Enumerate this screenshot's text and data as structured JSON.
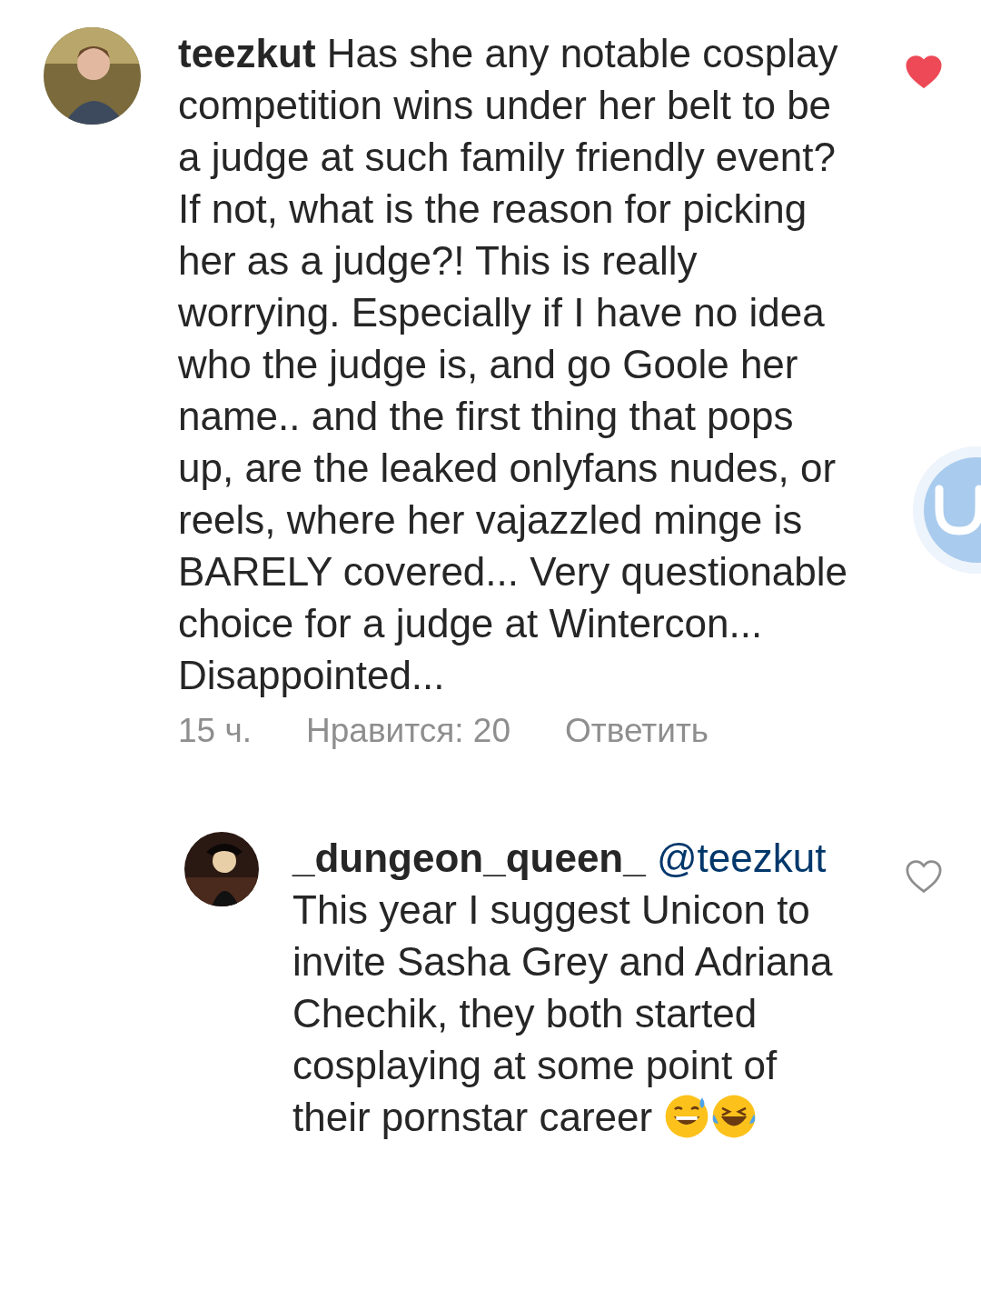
{
  "comments": [
    {
      "username": "teezkut",
      "text": "Has she any notable cosplay competition wins under her belt to be a judge at such family friendly event? If not, what is the reason for picking her as a judge?! This is really worrying. Especially if I have no idea who the judge is, and go Goole her name.. and the first thing that pops up, are the leaked onlyfans nudes, or reels, where her vajazzled minge is BARELY covered... Very questionable choice for a judge at Wintercon... Disappointed...",
      "liked": true,
      "reply": false,
      "meta": [
        "15 ч.",
        "Нравится: 20",
        "Ответить"
      ]
    },
    {
      "username": "_dungeon_queen_",
      "mention": "@teezkut",
      "text": "This year I suggest Unicon to invite Sasha Grey and Adriana Chechik, they both started cosplaying at some point of their pornstar career",
      "liked": false,
      "reply": true,
      "emoji": [
        {
          "kind": "sweat_smile"
        },
        {
          "kind": "laughing"
        }
      ]
    }
  ]
}
